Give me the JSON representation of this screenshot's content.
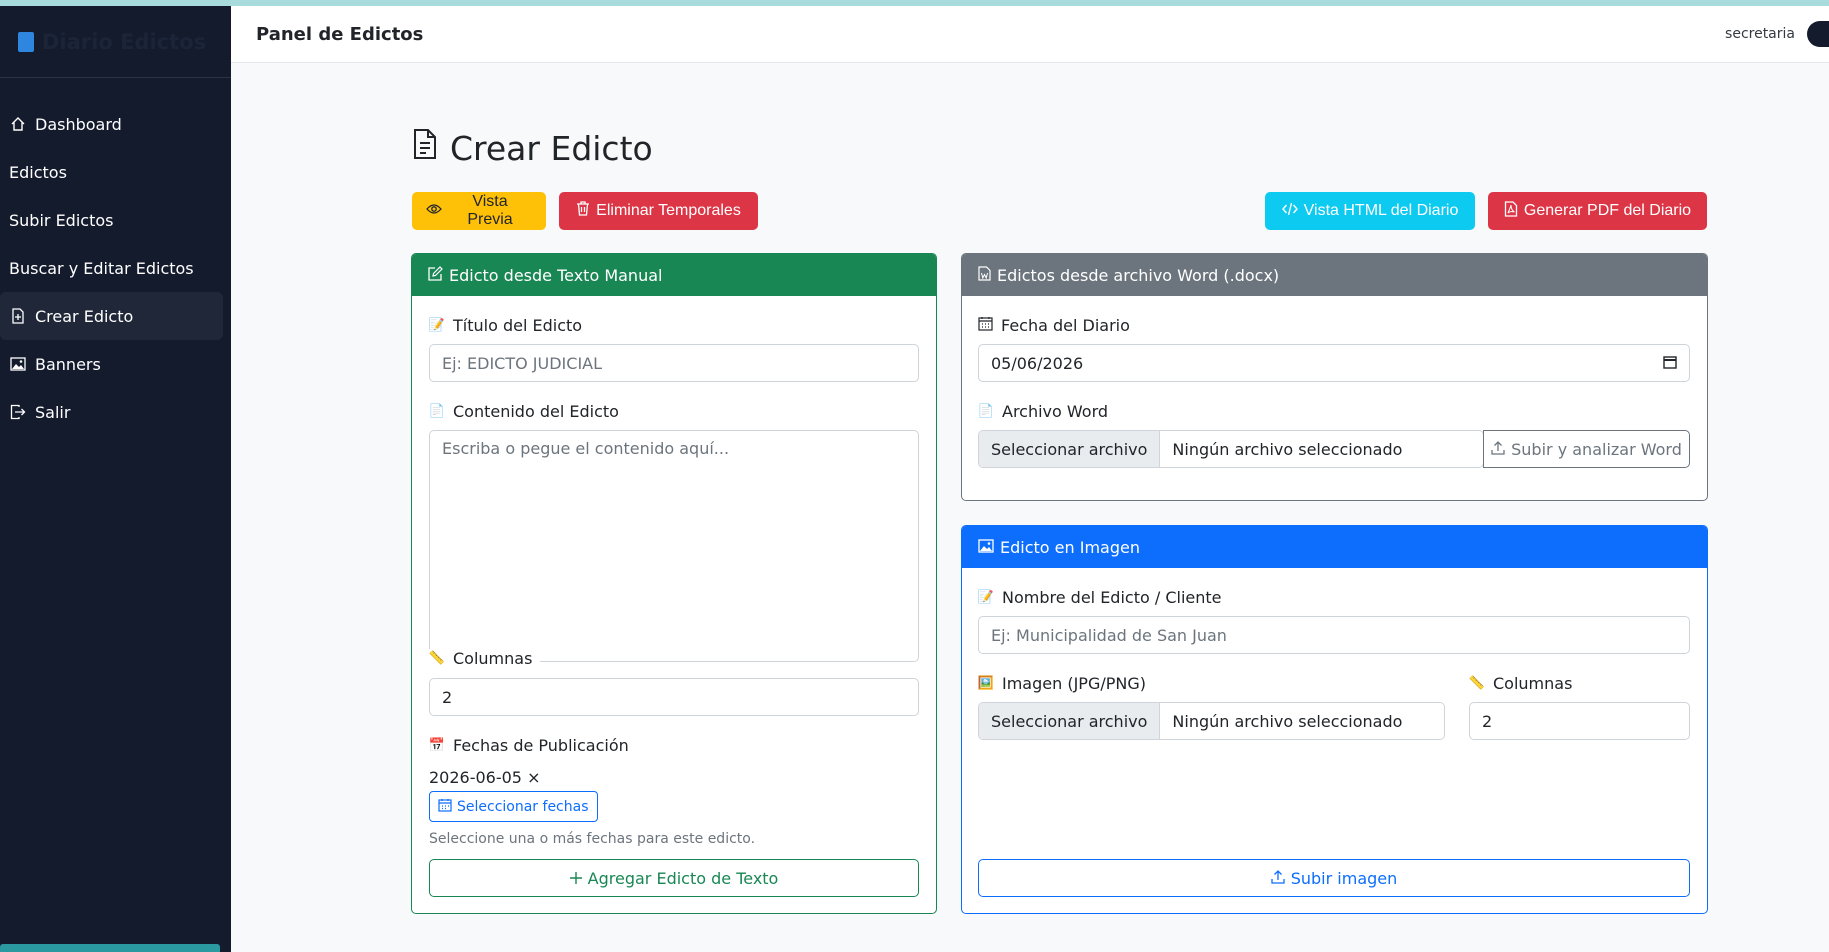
{
  "sidebar": {
    "brand": "Diario Edictos",
    "items": [
      {
        "label": "Dashboard",
        "icon": "house-icon"
      },
      {
        "label": "Edictos",
        "icon": ""
      },
      {
        "label": "Subir Edictos",
        "icon": ""
      },
      {
        "label": "Buscar y Editar Edictos",
        "icon": ""
      },
      {
        "label": "Crear Edicto",
        "icon": "file-plus-icon",
        "active": true
      },
      {
        "label": "Banners",
        "icon": "image-icon"
      },
      {
        "label": "Salir",
        "icon": "box-arrow-right-icon"
      }
    ]
  },
  "header": {
    "title": "Panel de Edictos",
    "user": "secretaria"
  },
  "page": {
    "title": "Crear Edicto"
  },
  "toolbar": {
    "preview": "Vista Previa",
    "delete_temp": "Eliminar Temporales",
    "html_view": "Vista HTML del Diario",
    "pdf": "Generar PDF del Diario"
  },
  "text_card": {
    "header": "Edicto desde Texto Manual",
    "title_label": "Título del Edicto",
    "title_placeholder": "Ej: EDICTO JUDICIAL",
    "content_label": "Contenido del Edicto",
    "content_placeholder": "Escriba o pegue el contenido aquí...",
    "columns_label": "Columnas",
    "columns_value": "2",
    "dates_label": "Fechas de Publicación",
    "selected_date": "2026-06-05 ×",
    "select_dates": "Seleccionar fechas",
    "help": "Seleccione una o más fechas para este edicto.",
    "submit": "Agregar Edicto de Texto"
  },
  "word_card": {
    "header": "Edictos desde archivo Word (.docx)",
    "date_label": "Fecha del Diario",
    "date_value": "05/06/2026",
    "file_label": "Archivo Word",
    "file_button": "Seleccionar archivo",
    "file_status": "Ningún archivo seleccionado",
    "upload": "Subir y analizar Word"
  },
  "image_card": {
    "header": "Edicto en Imagen",
    "name_label": "Nombre del Edicto / Cliente",
    "name_placeholder": "Ej: Municipalidad de San Juan",
    "image_label": "Imagen (JPG/PNG)",
    "file_button": "Seleccionar archivo",
    "file_status": "Ningún archivo seleccionado",
    "columns_label": "Columnas",
    "columns_value": "2",
    "upload": "Subir imagen"
  },
  "colors": {
    "sidebar": "#141b2d",
    "success": "#198754",
    "secondary": "#6c757d",
    "primary": "#0d6efd",
    "warning": "#ffc107",
    "danger": "#dc3545",
    "info": "#0dcaf0"
  }
}
